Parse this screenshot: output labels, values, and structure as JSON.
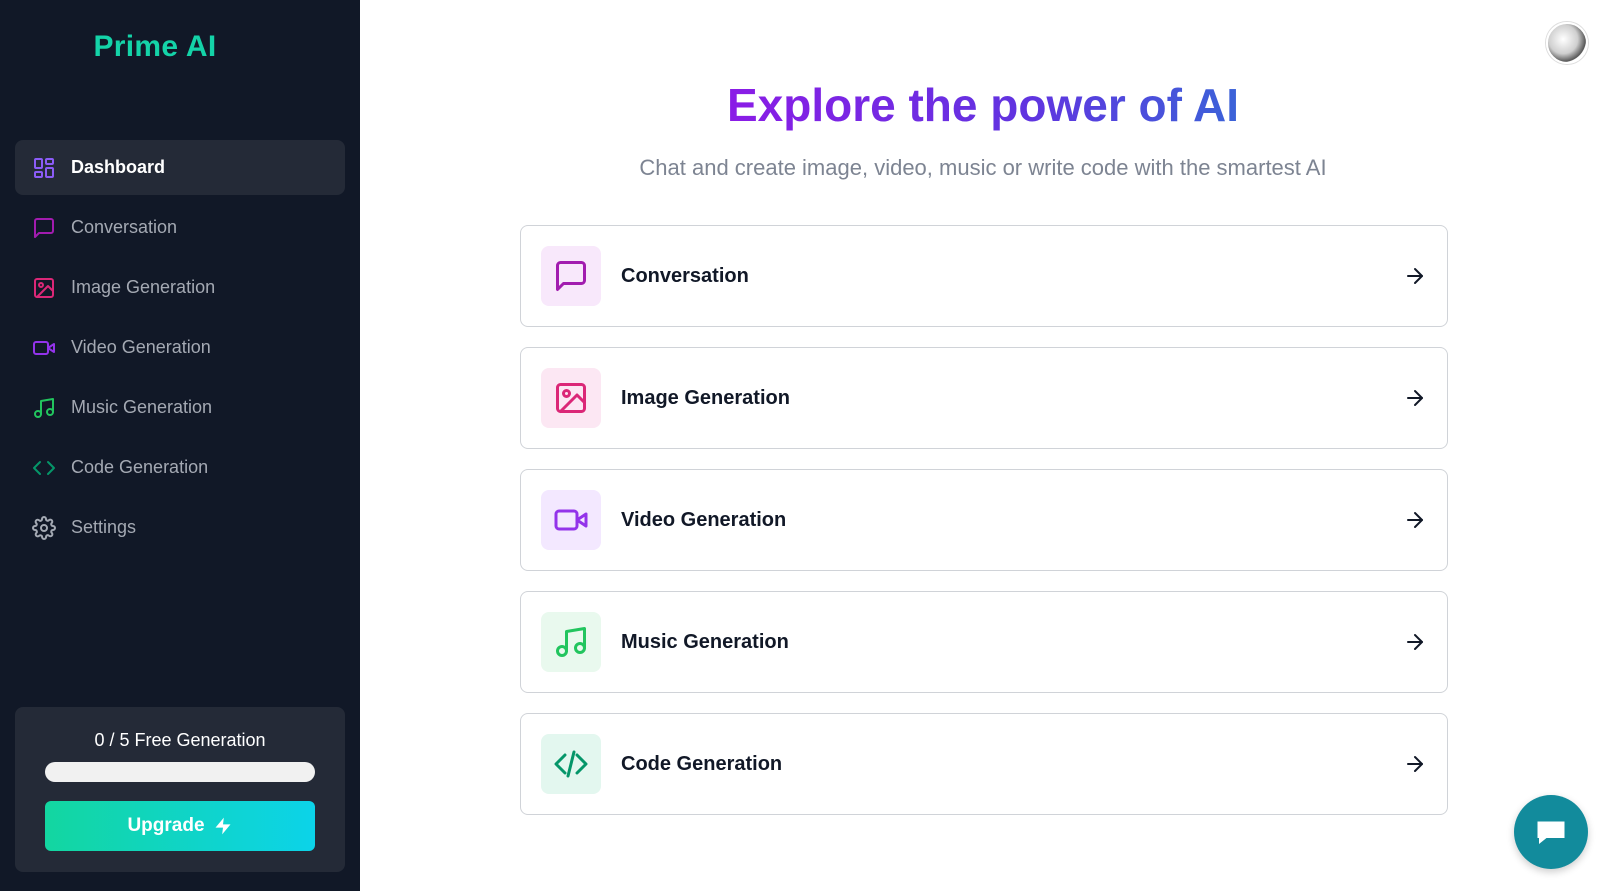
{
  "brand": {
    "name": "Prime AI"
  },
  "sidebar": {
    "items": [
      {
        "label": "Dashboard",
        "icon": "dashboard-icon",
        "color": "#8b5cf6",
        "active": true
      },
      {
        "label": "Conversation",
        "icon": "message-square-icon",
        "color": "#a21caf",
        "active": false
      },
      {
        "label": "Image Generation",
        "icon": "image-icon",
        "color": "#db2777",
        "active": false
      },
      {
        "label": "Video Generation",
        "icon": "video-icon",
        "color": "#9333ea",
        "active": false
      },
      {
        "label": "Music Generation",
        "icon": "music-icon",
        "color": "#22c55e",
        "active": false
      },
      {
        "label": "Code Generation",
        "icon": "code-icon",
        "color": "#059669",
        "active": false
      },
      {
        "label": "Settings",
        "icon": "gear-icon",
        "color": "#a4a9b3",
        "active": false
      }
    ]
  },
  "usage": {
    "text": "0 / 5 Free Generation",
    "used": 0,
    "limit": 5,
    "upgrade_label": "Upgrade"
  },
  "hero": {
    "title": "Explore the power of AI",
    "subtitle": "Chat and create image, video, music or write code with the smartest AI"
  },
  "cards": [
    {
      "label": "Conversation",
      "icon": "message-square-icon",
      "color": "#a21caf",
      "bg": "#f8e8fb"
    },
    {
      "label": "Image Generation",
      "icon": "image-icon",
      "color": "#db2777",
      "bg": "#fce7f3"
    },
    {
      "label": "Video Generation",
      "icon": "video-icon",
      "color": "#9333ea",
      "bg": "#f3e8ff"
    },
    {
      "label": "Music Generation",
      "icon": "music-icon",
      "color": "#22c55e",
      "bg": "#e9f9ee"
    },
    {
      "label": "Code Generation",
      "icon": "code-icon",
      "color": "#059669",
      "bg": "#e3f7ef"
    }
  ],
  "header": {
    "avatar_icon": "user-avatar"
  },
  "chat_widget": {
    "icon": "chat-bubble-icon",
    "color": "#128b9c"
  }
}
